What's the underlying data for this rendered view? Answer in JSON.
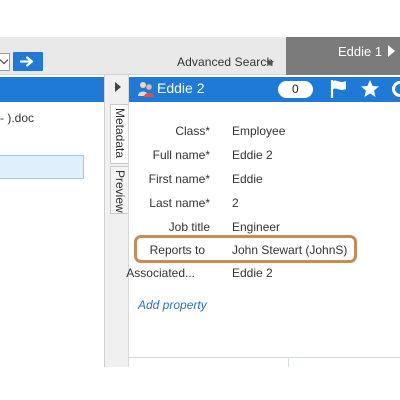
{
  "toolbar": {
    "advanced_search_label": "Advanced Search",
    "tab_label": "Eddie 1"
  },
  "left_pane": {
    "file_label": "- ).doc"
  },
  "object": {
    "title": "Eddie 2",
    "comment_count": "0"
  },
  "side_tabs": {
    "metadata": "Metadata",
    "preview": "Preview"
  },
  "properties": [
    {
      "label": "Class*",
      "value": "Employee"
    },
    {
      "label": "Full name*",
      "value": "Eddie 2"
    },
    {
      "label": "First name*",
      "value": "Eddie"
    },
    {
      "label": "Last name*",
      "value": "2"
    },
    {
      "label": "Job title",
      "value": "Engineer"
    },
    {
      "label": "Reports to",
      "value": "John Stewart (JohnS)"
    },
    {
      "label": "Associated...",
      "value": "Eddie 2"
    }
  ],
  "add_property_label": "Add property",
  "colors": {
    "accent_blue": "#1e7ad6",
    "highlight_ring": "#c98a54",
    "tab_grey": "#7b7b7b"
  },
  "icons": [
    "chevron-down-icon",
    "arrow-right-icon",
    "caret-down-icon",
    "play-arrow-icon",
    "users-icon",
    "flag-icon",
    "star-icon",
    "gear-icon"
  ]
}
